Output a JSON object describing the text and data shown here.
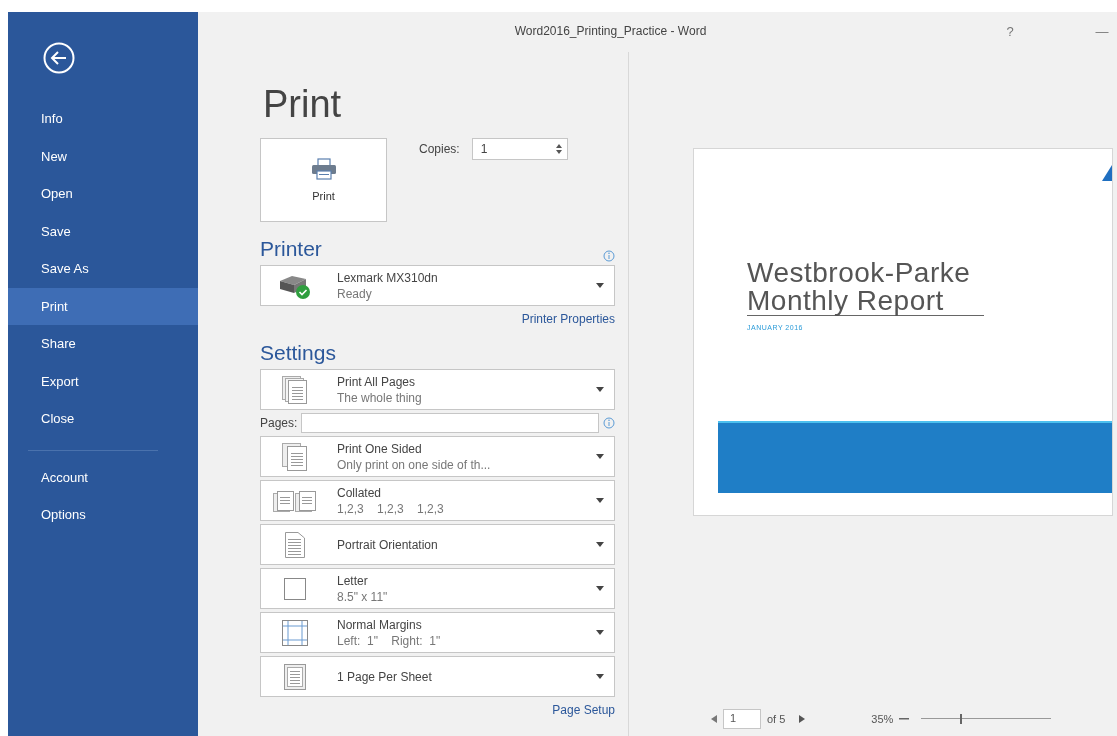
{
  "window": {
    "title": "Word2016_Printing_Practice - Word",
    "controls": [
      "?",
      "—"
    ]
  },
  "sidebar": {
    "items": [
      {
        "label": "Info",
        "selected": false
      },
      {
        "label": "New",
        "selected": false
      },
      {
        "label": "Open",
        "selected": false
      },
      {
        "label": "Save",
        "selected": false
      },
      {
        "label": "Save As",
        "selected": false
      },
      {
        "label": "Print",
        "selected": true
      },
      {
        "label": "Share",
        "selected": false
      },
      {
        "label": "Export",
        "selected": false
      },
      {
        "label": "Close",
        "selected": false
      }
    ],
    "bottom_items": [
      {
        "label": "Account",
        "selected": false
      },
      {
        "label": "Options",
        "selected": false
      }
    ]
  },
  "print_panel": {
    "heading": "Print",
    "print_button": "Print",
    "copies": {
      "label": "Copies:",
      "value": "1"
    },
    "printer": {
      "heading": "Printer",
      "name": "Lexmark MX310dn",
      "status": "Ready",
      "properties_link": "Printer Properties"
    },
    "settings": {
      "heading": "Settings",
      "options": [
        {
          "kind": "pages-range",
          "title": "Print All Pages",
          "subtitle": "The whole thing"
        },
        {
          "kind": "field",
          "label": "Pages:"
        },
        {
          "kind": "sides",
          "title": "Print One Sided",
          "subtitle": "Only print on one side of th..."
        },
        {
          "kind": "collate",
          "title": "Collated",
          "subtitle": "1,2,3    1,2,3    1,2,3"
        },
        {
          "kind": "orientation",
          "title": "Portrait Orientation"
        },
        {
          "kind": "paper-size",
          "title": "Letter",
          "subtitle": "8.5\" x 11\""
        },
        {
          "kind": "margins",
          "title": "Normal Margins",
          "subtitle": "Left:  1\"    Right:  1\""
        },
        {
          "kind": "pages-per-sheet",
          "title": "1 Page Per Sheet"
        }
      ],
      "page_setup_link": "Page Setup"
    }
  },
  "preview": {
    "document": {
      "title_lines": [
        "Westbrook-Parke",
        "Monthly Report"
      ],
      "date": "JANUARY 2016"
    },
    "navigation": {
      "page": "1",
      "of": "of 5"
    },
    "zoom": {
      "value": "35%",
      "level": 0.3
    }
  }
}
